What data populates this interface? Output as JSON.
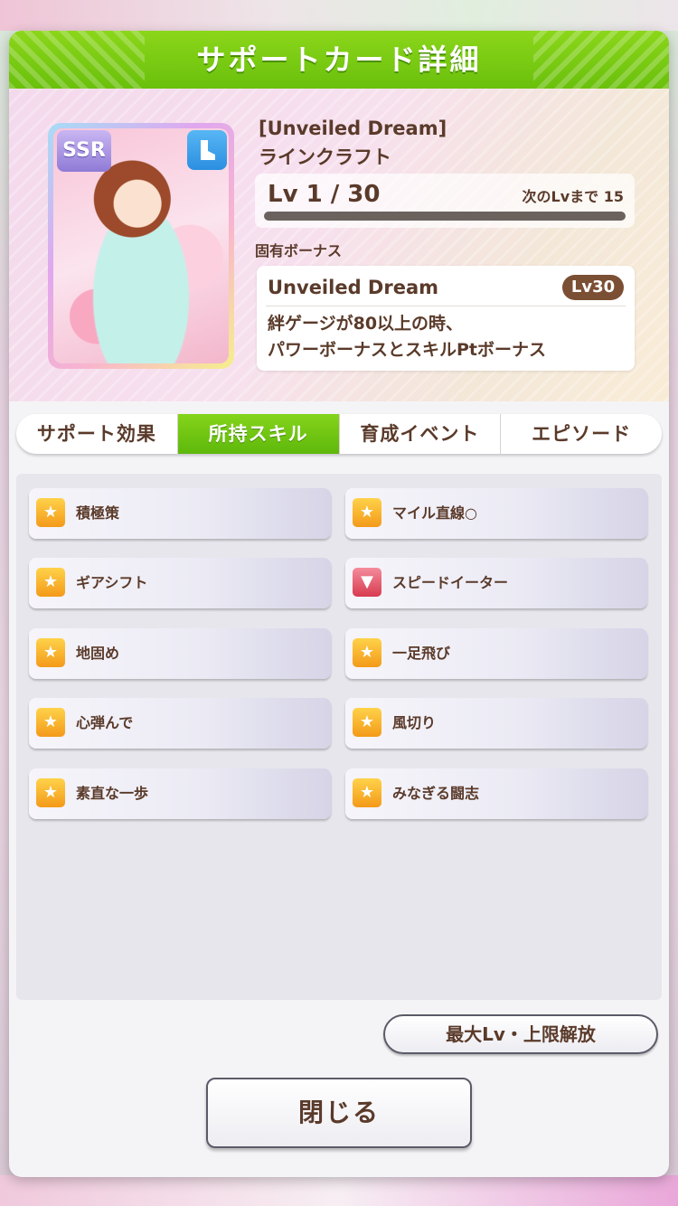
{
  "header": {
    "title": "サポートカード詳細"
  },
  "card": {
    "rarity": "SSR",
    "type_icon": "shoe-icon",
    "title_en": "[Unveiled Dream]",
    "title_ja": "ラインクラフト",
    "level_text": "Lv 1 / 30",
    "next_level_text": "次のLvまで 15",
    "level_progress": 0
  },
  "unique_bonus": {
    "label": "固有ボーナス",
    "name": "Unveiled Dream",
    "level": "Lv30",
    "desc_line1": "絆ゲージが80以上の時、",
    "desc_line2": "パワーボーナスとスキルPtボーナス"
  },
  "tabs": [
    {
      "label": "サポート効果",
      "active": false
    },
    {
      "label": "所持スキル",
      "active": true
    },
    {
      "label": "育成イベント",
      "active": false
    },
    {
      "label": "エピソード",
      "active": false
    }
  ],
  "skills": [
    {
      "name": "積極策",
      "icon": "gold-skill-icon"
    },
    {
      "name": "マイル直線○",
      "icon": "gold-skill-icon"
    },
    {
      "name": "ギアシフト",
      "icon": "gold-skill-icon"
    },
    {
      "name": "スピードイーター",
      "icon": "red-debuff-skill-icon"
    },
    {
      "name": "地固め",
      "icon": "gold-skill-icon"
    },
    {
      "name": "一足飛び",
      "icon": "gold-skill-icon"
    },
    {
      "name": "心弾んで",
      "icon": "gold-skill-icon"
    },
    {
      "name": "風切り",
      "icon": "gold-skill-icon"
    },
    {
      "name": "素直な一歩",
      "icon": "gold-skill-icon"
    },
    {
      "name": "みなぎる闘志",
      "icon": "gold-skill-icon"
    }
  ],
  "buttons": {
    "max_level": "最大Lv・上限解放",
    "close": "閉じる"
  }
}
